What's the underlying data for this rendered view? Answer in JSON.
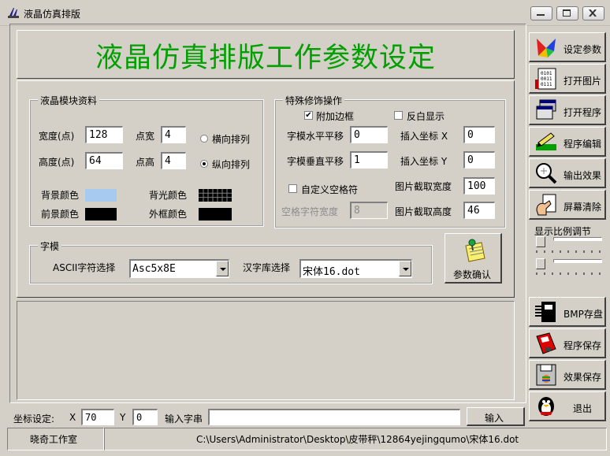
{
  "window": {
    "title": "液晶仿真排版"
  },
  "header": {
    "title": "液晶仿真排版工作参数设定"
  },
  "lcd_module": {
    "group_label": "液晶模块资料",
    "width_label": "宽度(点)",
    "width_value": "128",
    "height_label": "高度(点)",
    "height_value": "64",
    "dot_width_label": "点宽",
    "dot_width_value": "4",
    "dot_height_label": "点高",
    "dot_height_value": "4",
    "horizontal_label": "横向排列",
    "vertical_label": "纵向排列",
    "bg_color_label": "背景颜色",
    "backlight_color_label": "背光颜色",
    "fg_color_label": "前景颜色",
    "frame_color_label": "外框颜色",
    "colors": {
      "bg": "#a6caf0",
      "fg": "#000000",
      "frame": "#000000",
      "backlight": "#000000"
    }
  },
  "special": {
    "group_label": "特殊修饰操作",
    "add_border_label": "附加边框",
    "invert_label": "反白显示",
    "h_offset_label": "字模水平平移",
    "h_offset_value": "0",
    "v_offset_label": "字模垂直平移",
    "v_offset_value": "1",
    "insert_x_label": "插入坐标 X",
    "insert_x_value": "0",
    "insert_y_label": "插入坐标 Y",
    "insert_y_value": "0",
    "custom_space_label": "自定义空格符",
    "space_width_label": "空格字符宽度",
    "space_width_value": "8",
    "crop_width_label": "图片截取宽度",
    "crop_width_value": "100",
    "crop_height_label": "图片截取高度",
    "crop_height_value": "46"
  },
  "font": {
    "group_label": "字模",
    "ascii_label": "ASCII字符选择",
    "ascii_value": "Asc5x8E",
    "hanzi_label": "汉字库选择",
    "hanzi_value": "宋体16.dot",
    "confirm_label": "参数确认"
  },
  "sidebar": {
    "set_params": "设定参数",
    "open_image": "打开图片",
    "open_program": "打开程序",
    "edit_program": "程序编辑",
    "output_effect": "输出效果",
    "clear_screen": "屏幕清除",
    "scale_label": "显示比例调节",
    "bmp_save": "BMP存盘",
    "program_save": "程序保存",
    "effect_save": "效果保存",
    "exit": "退出"
  },
  "bottom": {
    "coord_label": "坐标设定:",
    "x_label": "X",
    "x_value": "70",
    "y_label": "Y",
    "y_value": "0",
    "input_label": "输入字串",
    "input_value": "",
    "input_button": "输入"
  },
  "statusbar": {
    "studio": "晓奇工作室",
    "path": "C:\\Users\\Administrator\\Desktop\\皮带秤\\12864yejingqumo\\宋体16.dot"
  }
}
